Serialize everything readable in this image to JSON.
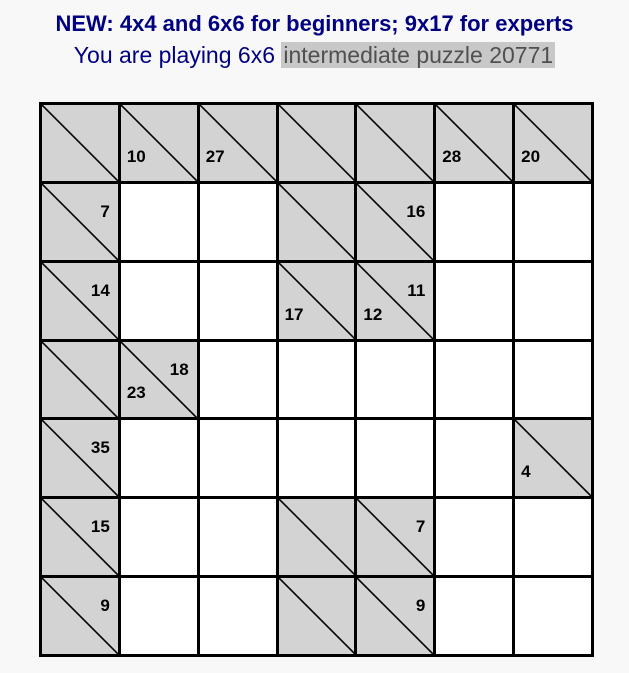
{
  "header": {
    "line1": "NEW: 4x4 and 6x6 for beginners; 9x17 for experts",
    "line2_prefix": "You are playing 6x6 ",
    "puzzle_label": "intermediate puzzle 20771"
  },
  "board": {
    "rows": 7,
    "cols": 7,
    "cells": [
      [
        {
          "type": "clue",
          "down": "",
          "right": ""
        },
        {
          "type": "clue",
          "down": "10",
          "right": ""
        },
        {
          "type": "clue",
          "down": "27",
          "right": ""
        },
        {
          "type": "clue",
          "down": "",
          "right": ""
        },
        {
          "type": "clue",
          "down": "",
          "right": ""
        },
        {
          "type": "clue",
          "down": "28",
          "right": ""
        },
        {
          "type": "clue",
          "down": "20",
          "right": ""
        }
      ],
      [
        {
          "type": "clue",
          "down": "",
          "right": "7"
        },
        {
          "type": "empty"
        },
        {
          "type": "empty"
        },
        {
          "type": "clue",
          "down": "",
          "right": ""
        },
        {
          "type": "clue",
          "down": "",
          "right": "16"
        },
        {
          "type": "empty"
        },
        {
          "type": "empty"
        }
      ],
      [
        {
          "type": "clue",
          "down": "",
          "right": "14"
        },
        {
          "type": "empty"
        },
        {
          "type": "empty"
        },
        {
          "type": "clue",
          "down": "17",
          "right": ""
        },
        {
          "type": "clue",
          "down": "12",
          "right": "11"
        },
        {
          "type": "empty"
        },
        {
          "type": "empty"
        }
      ],
      [
        {
          "type": "clue",
          "down": "",
          "right": ""
        },
        {
          "type": "clue",
          "down": "23",
          "right": "18"
        },
        {
          "type": "empty"
        },
        {
          "type": "empty"
        },
        {
          "type": "empty"
        },
        {
          "type": "empty"
        },
        {
          "type": "empty"
        }
      ],
      [
        {
          "type": "clue",
          "down": "",
          "right": "35"
        },
        {
          "type": "empty"
        },
        {
          "type": "empty"
        },
        {
          "type": "empty"
        },
        {
          "type": "empty"
        },
        {
          "type": "empty"
        },
        {
          "type": "clue",
          "down": "4",
          "right": ""
        }
      ],
      [
        {
          "type": "clue",
          "down": "",
          "right": "15"
        },
        {
          "type": "empty"
        },
        {
          "type": "empty"
        },
        {
          "type": "clue",
          "down": "",
          "right": ""
        },
        {
          "type": "clue",
          "down": "",
          "right": "7"
        },
        {
          "type": "empty"
        },
        {
          "type": "empty"
        }
      ],
      [
        {
          "type": "clue",
          "down": "",
          "right": "9"
        },
        {
          "type": "empty"
        },
        {
          "type": "empty"
        },
        {
          "type": "clue",
          "down": "",
          "right": ""
        },
        {
          "type": "clue",
          "down": "",
          "right": "9"
        },
        {
          "type": "empty"
        },
        {
          "type": "empty"
        }
      ]
    ]
  }
}
